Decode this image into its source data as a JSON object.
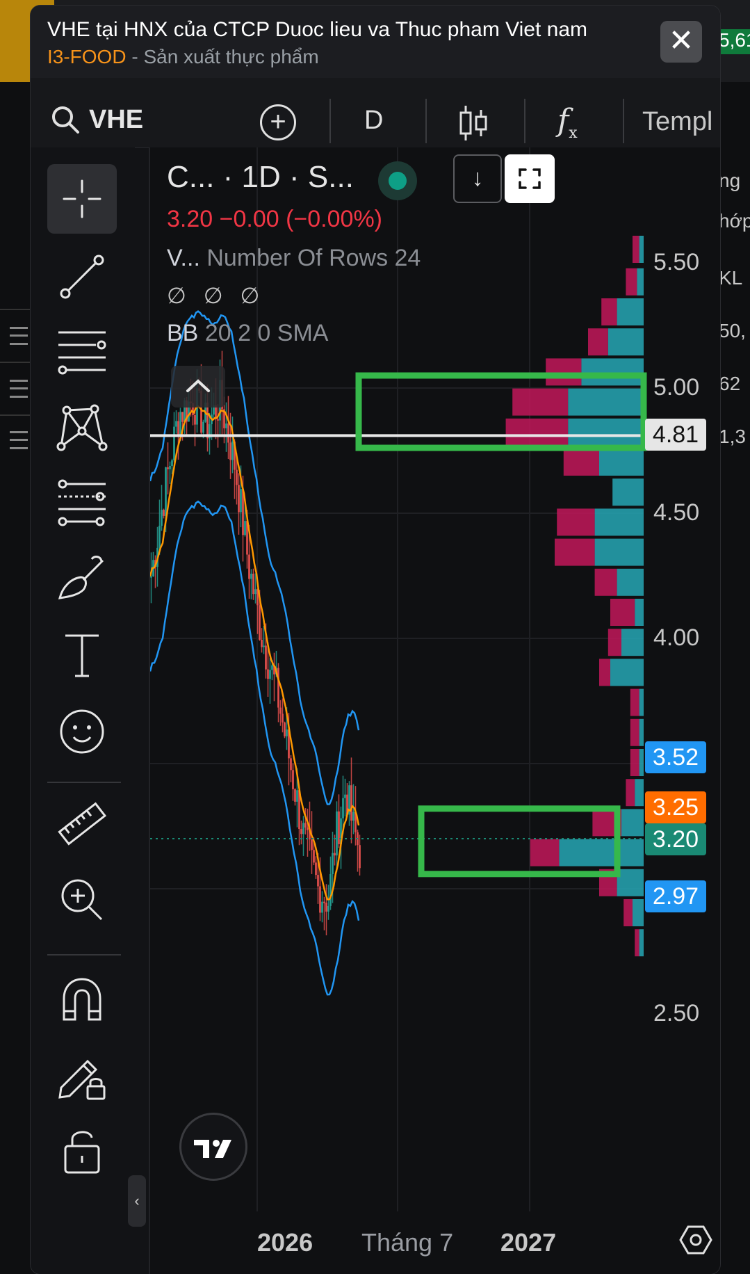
{
  "background": {
    "right_values": [
      "5,61",
      "ng",
      "hớp",
      "KL",
      "50,",
      "62",
      "1,3"
    ]
  },
  "dialog": {
    "title": "VHE tại HNX của CTCP Duoc lieu va Thuc pham Viet nam",
    "sector_code": "I3-FOOD",
    "sector_separator": " - ",
    "sector_name": "Sản xuất thực phẩm",
    "close_icon": "close-icon"
  },
  "toolbar": {
    "symbol": "VHE",
    "interval": "D",
    "indicators_label": "f",
    "indicators_sub": "x",
    "templates_label": "Templ"
  },
  "legend": {
    "line1": "C...  · 1D · S...",
    "price": "3.20  −0.00 (−0.00%)",
    "vp_short": "V...",
    "vp_params": " Number Of Rows 24",
    "null_values": "∅ ∅ ∅",
    "bb_name": "BB",
    "bb_params": " 20 2 0 SMA"
  },
  "price_axis": {
    "labels": [
      "5.50",
      "5.00",
      "4.50",
      "4.00",
      "2.50"
    ],
    "current_line_tag": "4.81",
    "tag_upper": "3.52",
    "tag_ma": "3.25",
    "tag_last": "3.20",
    "tag_lower": "2.97"
  },
  "time_axis": {
    "labels": [
      "2026",
      "Tháng 7",
      "2027"
    ]
  },
  "colors": {
    "up": "#26a69a",
    "down": "#ef5350",
    "bb_band": "#2196f3",
    "ma": "#ff9800",
    "vp_up": "#26a7b5",
    "vp_down": "#c2185b",
    "highlight": "#36b84a"
  },
  "chart_data": {
    "type": "candlestick-with-volume-profile",
    "symbol": "VHE",
    "interval": "1D",
    "last_price": 3.2,
    "change": -0.0,
    "change_pct": -0.0,
    "ylim": [
      2.5,
      5.6
    ],
    "yticks": [
      2.5,
      4.0,
      4.5,
      5.0,
      5.5
    ],
    "horizontal_line": 4.81,
    "bb_upper": 3.52,
    "bb_basis": 3.25,
    "bb_lower": 2.97,
    "volume_profile_rows": [
      {
        "price": 5.55,
        "up": 0.02,
        "down": 0.03
      },
      {
        "price": 5.42,
        "up": 0.03,
        "down": 0.05
      },
      {
        "price": 5.3,
        "up": 0.12,
        "down": 0.07
      },
      {
        "price": 5.18,
        "up": 0.16,
        "down": 0.09
      },
      {
        "price": 5.06,
        "up": 0.28,
        "down": 0.16
      },
      {
        "price": 4.94,
        "up": 0.34,
        "down": 0.25
      },
      {
        "price": 4.82,
        "up": 0.34,
        "down": 0.28
      },
      {
        "price": 4.7,
        "up": 0.2,
        "down": 0.16
      },
      {
        "price": 4.58,
        "up": 0.14,
        "down": 0.0
      },
      {
        "price": 4.46,
        "up": 0.22,
        "down": 0.17
      },
      {
        "price": 4.34,
        "up": 0.22,
        "down": 0.18
      },
      {
        "price": 4.22,
        "up": 0.12,
        "down": 0.1
      },
      {
        "price": 4.1,
        "up": 0.04,
        "down": 0.11
      },
      {
        "price": 3.98,
        "up": 0.1,
        "down": 0.06
      },
      {
        "price": 3.86,
        "up": 0.15,
        "down": 0.05
      },
      {
        "price": 3.74,
        "up": 0.02,
        "down": 0.04
      },
      {
        "price": 3.62,
        "up": 0.02,
        "down": 0.04
      },
      {
        "price": 3.5,
        "up": 0.02,
        "down": 0.04
      },
      {
        "price": 3.38,
        "up": 0.04,
        "down": 0.04
      },
      {
        "price": 3.26,
        "up": 0.1,
        "down": 0.13
      },
      {
        "price": 3.14,
        "up": 0.38,
        "down": 0.13
      },
      {
        "price": 3.02,
        "up": 0.12,
        "down": 0.08
      },
      {
        "price": 2.9,
        "up": 0.05,
        "down": 0.04
      },
      {
        "price": 2.78,
        "up": 0.02,
        "down": 0.02
      }
    ]
  }
}
